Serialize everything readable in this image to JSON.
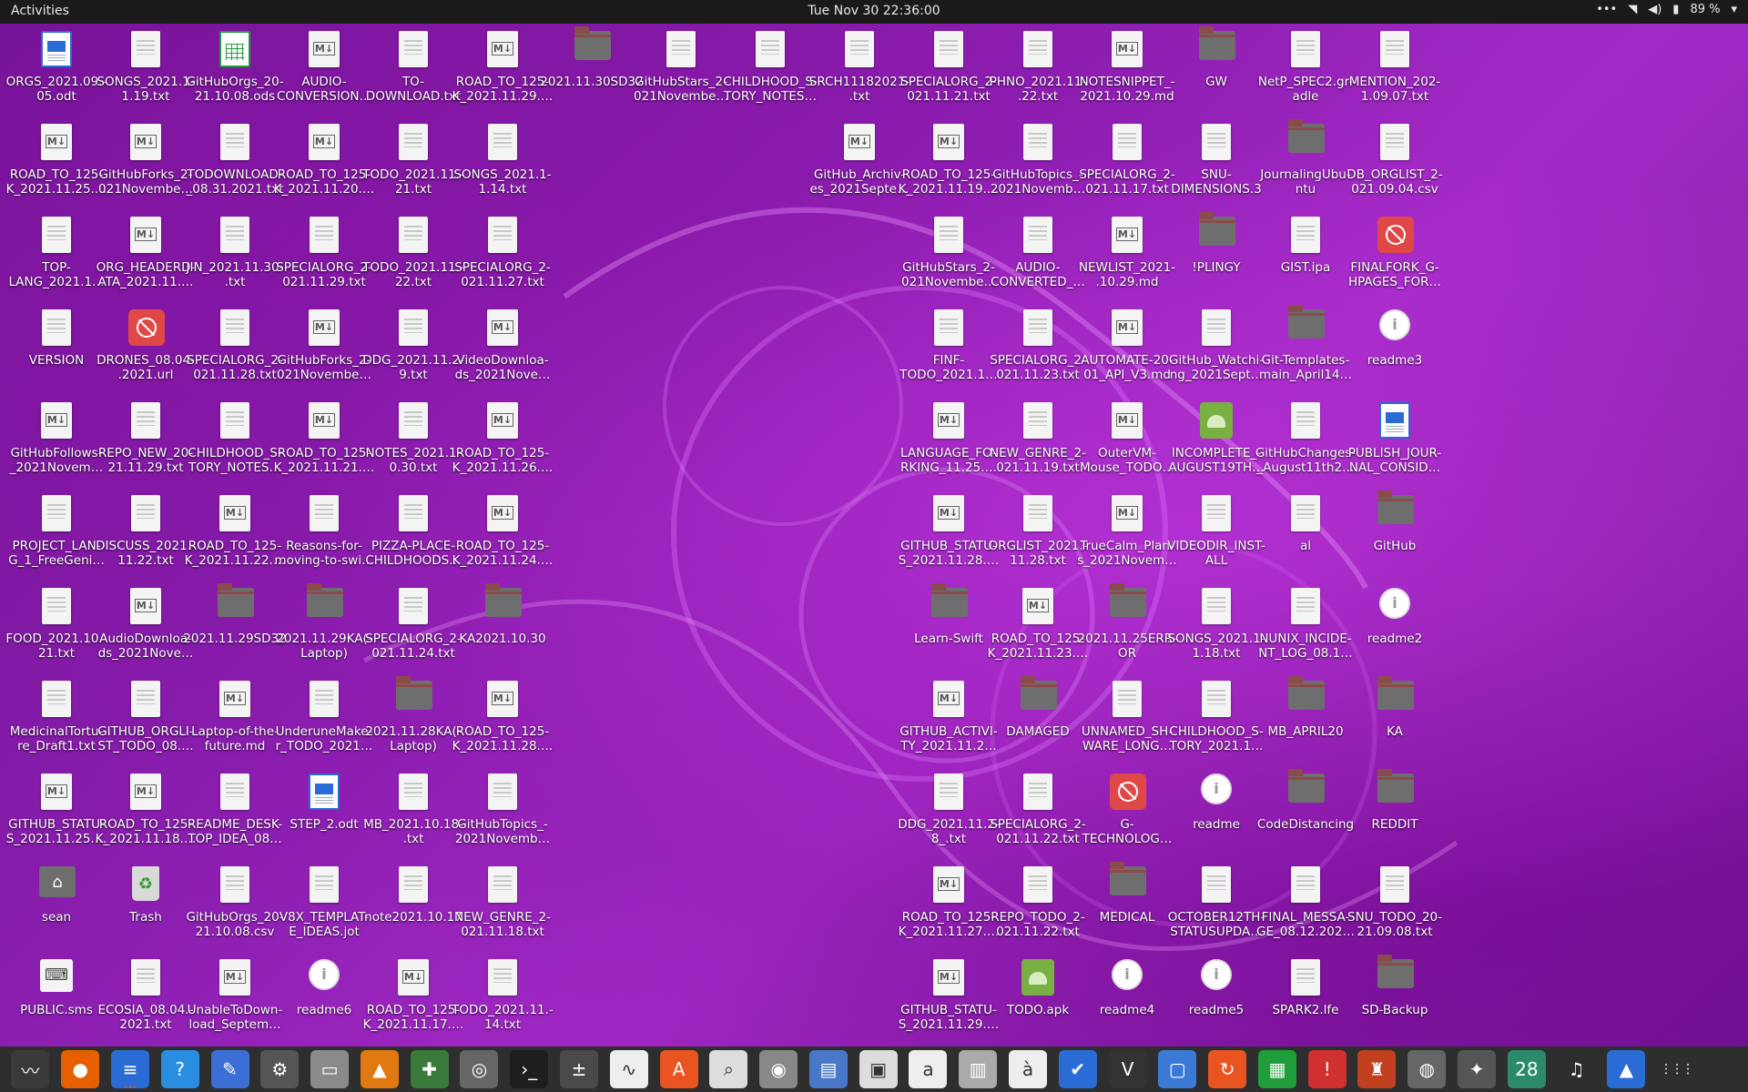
{
  "topbar": {
    "activities": "Activities",
    "clock": "Tue Nov 30  22:36:00",
    "battery": "89 %",
    "menu_dots": "•••"
  },
  "desktop_icons": [
    [
      "ORGS_2021.09.-\n05.odt",
      "odt"
    ],
    [
      "SONGS_2021.1-\n1.19.txt",
      "doc"
    ],
    [
      "GitHubOrgs_20-\n21.10.08.ods",
      "ods"
    ],
    [
      "AUDIO-\nCONVERSION…",
      "md"
    ],
    [
      "TO-\nDOWNLOAD.txt",
      "doc"
    ],
    [
      "ROAD_TO_125-\nK_2021.11.29.…",
      "md"
    ],
    [
      "2021.11.30SD32",
      "folder"
    ],
    [
      "GitHubStars_2-\n021Novembe…",
      "doc"
    ],
    [
      "CHILDHOOD_S-\nTORY_NOTES…",
      "doc"
    ],
    [
      "SRCH11182021-\n.txt",
      "doc"
    ],
    [
      "SPECIALORG_2-\n021.11.21.txt",
      "doc"
    ],
    [
      "PHNO_2021.11-\n.22.txt",
      "doc"
    ],
    [
      "NOTESNIPPET_-\n2021.10.29.md",
      "md"
    ],
    [
      "GW",
      "folder"
    ],
    [
      "NetP_SPEC2.gr-\nadle",
      "doc"
    ],
    [
      "MENTION_202-\n1.09.07.txt",
      "doc"
    ],
    [
      "ROAD_TO_125-\nK_2021.11.25.…",
      "md"
    ],
    [
      "GitHubForks_2-\n021Novembe…",
      "md"
    ],
    [
      "TODOWNLOAD-\n_08.31.2021.txt",
      "doc"
    ],
    [
      "ROAD_TO_125-\nK_2021.11.20.…",
      "md"
    ],
    [
      "TODO_2021.11.-\n21.txt",
      "doc"
    ],
    [
      "SONGS_2021.1-\n1.14.txt",
      "doc"
    ],
    [
      "GitHub_Archiv-\nes_2021Septe…",
      "md"
    ],
    [
      "ROAD_TO_125-\nK_2021.11.19.…",
      "md"
    ],
    [
      "GitHubTopics_-\n2021Novemb…",
      "doc"
    ],
    [
      "SPECIALORG_2-\n021.11.17.txt",
      "doc"
    ],
    [
      "SNU-\nDIMENSIONS.3",
      "doc"
    ],
    [
      "JournalingUbu-\nntu",
      "folder"
    ],
    [
      "DB_ORGLIST_2-\n021.09.04.csv",
      "doc"
    ],
    [
      "TOP-\nLANG_2021.1…",
      "doc"
    ],
    [
      "ORG_HEADERD-\nATA_2021.11.…",
      "md"
    ],
    [
      "JIN_2021.11.30-\n.txt",
      "doc"
    ],
    [
      "SPECIALORG_2-\n021.11.29.txt",
      "doc"
    ],
    [
      "TODO_2021.11.-\n22.txt",
      "doc"
    ],
    [
      "SPECIALORG_2-\n021.11.27.txt",
      "doc"
    ],
    [
      "GitHubStars_2-\n021Novembe…",
      "doc"
    ],
    [
      "AUDIO-\nCONVERTED_…",
      "doc"
    ],
    [
      "NEWLIST_2021-\n.10.29.md",
      "md"
    ],
    [
      "!PLINGY",
      "folder"
    ],
    [
      "GIST.ipa",
      "doc"
    ],
    [
      "FINALFORK_G-\nHPAGES_FOR…",
      "blocked"
    ],
    [
      "VERSION",
      "doc"
    ],
    [
      "DRONES_08.04-\n.2021.url",
      "blocked"
    ],
    [
      "SPECIALORG_2-\n021.11.28.txt",
      "doc"
    ],
    [
      "GitHubForks_2-\n021Novembe…",
      "md"
    ],
    [
      "DDG_2021.11.2-\n9.txt",
      "doc"
    ],
    [
      "VideoDownloa-\nds_2021Nove…",
      "md"
    ],
    [
      "FINF-\nTODO_2021.1…",
      "doc"
    ],
    [
      "SPECIALORG_2-\n021.11.23.txt",
      "doc"
    ],
    [
      "AUTOMATE-20-\n01_API_V3.md",
      "md"
    ],
    [
      "GitHub_Watchi-\nng_2021Sept…",
      "doc"
    ],
    [
      "Git-Templates-\nmain_April14…",
      "folder"
    ],
    [
      "readme3",
      "info"
    ],
    [
      "GitHubFollows-\n_2021Novem…",
      "md"
    ],
    [
      "REPO_NEW_20-\n21.11.29.txt",
      "doc"
    ],
    [
      "CHILDHOOD_S-\nTORY_NOTES…",
      "doc"
    ],
    [
      "ROAD_TO_125-\nK_2021.11.21.…",
      "md"
    ],
    [
      "NOTES_2021.1-\n0.30.txt",
      "doc"
    ],
    [
      "ROAD_TO_125-\nK_2021.11.26.…",
      "md"
    ],
    [
      "LANGUAGE_FO-\nRKING_11.25.…",
      "md"
    ],
    [
      "NEW_GENRE_2-\n021.11.19.txt",
      "doc"
    ],
    [
      "OuterVM-\nMouse_TODO…",
      "md"
    ],
    [
      "INCOMPLETE_-\nAUGUST19TH…",
      "apk"
    ],
    [
      "GitHubChanges-\n_August11th2…",
      "doc"
    ],
    [
      "PUBLISH_JOUR-\nNAL_CONSID…",
      "odt"
    ],
    [
      "PROJECT_LAN-\nG_1_FreeGeni…",
      "doc"
    ],
    [
      "DISCUSS_2021.-\n11.22.txt",
      "doc"
    ],
    [
      "ROAD_TO_125-\nK_2021.11.22.…",
      "md"
    ],
    [
      "Reasons-for-\nmoving-to-swi…",
      "doc"
    ],
    [
      "PIZZA-PLACE-\nCHILDHOODS…",
      "doc"
    ],
    [
      "ROAD_TO_125-\nK_2021.11.24.…",
      "md"
    ],
    [
      "GITHUB_STATU-\nS_2021.11.28.…",
      "md"
    ],
    [
      "ORGLIST_2021.-\n11.28.txt",
      "doc"
    ],
    [
      "TrueCalm_Plan-\ns_2021Novem…",
      "md"
    ],
    [
      "VIDEODIR_INST-\nALL",
      "doc"
    ],
    [
      "al",
      "doc"
    ],
    [
      "GitHub",
      "folder"
    ],
    [
      "FOOD_2021.10.-\n21.txt",
      "doc"
    ],
    [
      "AudioDownloa-\nds_2021Nove…",
      "md"
    ],
    [
      "2021.11.29SD32",
      "folder"
    ],
    [
      "2021.11.29KA(-\nLaptop)",
      "folder"
    ],
    [
      "SPECIALORG_2-\n021.11.24.txt",
      "doc"
    ],
    [
      "KA2021.10.30",
      "folder"
    ],
    [
      "Learn-Swift",
      "folder"
    ],
    [
      "ROAD_TO_125-\nK_2021.11.23.…",
      "md"
    ],
    [
      "2021.11.25ERR-\nOR",
      "folder"
    ],
    [
      "SONGS_2021.1-\n1.18.txt",
      "doc"
    ],
    [
      "NUNIX_INCIDE-\nNT_LOG_08.1…",
      "doc"
    ],
    [
      "readme2",
      "info"
    ],
    [
      "MedicinalTortu-\nre_Draft1.txt",
      "doc"
    ],
    [
      "GITHUB_ORGLI-\nST_TODO_08.…",
      "doc"
    ],
    [
      "Laptop-of-the-\nfuture.md",
      "md"
    ],
    [
      "UnderuneMake-\nr_TODO_2021…",
      "doc"
    ],
    [
      "2021.11.28KA(-\nLaptop)",
      "folder"
    ],
    [
      "ROAD_TO_125-\nK_2021.11.28.…",
      "md"
    ],
    [
      "GITHUB_ACTIVI-\nTY_2021.11.2…",
      "md"
    ],
    [
      "DAMAGED",
      "folder"
    ],
    [
      "UNNAMED_SH-\nWARE_LONG…",
      "doc"
    ],
    [
      "CHILDHOOD_S-\nTORY_2021.1…",
      "doc"
    ],
    [
      "MB_APRIL20",
      "folder"
    ],
    [
      "KA",
      "folder"
    ],
    [
      "GITHUB_STATU-\nS_2021.11.25.…",
      "md"
    ],
    [
      "ROAD_TO_125-\nK_2021.11.18.…",
      "md"
    ],
    [
      "README_DESK-\nTOP_IDEA_08…",
      "doc"
    ],
    [
      "STEP_2.odt",
      "odt"
    ],
    [
      "MB_2021.10.18-\n.txt",
      "doc"
    ],
    [
      "GitHubTopics_-\n2021Novemb…",
      "doc"
    ],
    [
      "DDG_2021.11.2-\n8_.txt",
      "doc"
    ],
    [
      "SPECIALORG_2-\n021.11.22.txt",
      "doc"
    ],
    [
      "G-\nTECHNOLOG…",
      "blocked"
    ],
    [
      "readme",
      "info"
    ],
    [
      "CodeDistancing",
      "folder"
    ],
    [
      "REDDIT",
      "folder"
    ],
    [
      "sean",
      "home"
    ],
    [
      "Trash",
      "trash"
    ],
    [
      "GitHubOrgs_20-\n21.10.08.csv",
      "doc"
    ],
    [
      "V8X_TEMPLAT-\nE_IDEAS.jot",
      "doc"
    ],
    [
      "note2021.10.17",
      "doc"
    ],
    [
      "NEW_GENRE_2-\n021.11.18.txt",
      "doc"
    ],
    [
      "ROAD_TO_125-\nK_2021.11.27.…",
      "md"
    ],
    [
      "REPO_TODO_2-\n021.11.22.txt",
      "doc"
    ],
    [
      "MEDICAL",
      "folder"
    ],
    [
      "OCTOBER12TH-\nSTATUSUPDA…",
      "doc"
    ],
    [
      "FINAL_MESSA-\nGE_08.12.202…",
      "doc"
    ],
    [
      "SNU_TODO_20-\n21.09.08.txt",
      "doc"
    ],
    [
      "PUBLIC.sms",
      "sms"
    ],
    [
      "ECOSIA_08.04.-\n2021.txt",
      "doc"
    ],
    [
      "UnableToDown-\nload_Septem…",
      "md"
    ],
    [
      "readme6",
      "info"
    ],
    [
      "ROAD_TO_125-\nK_2021.11.17.…",
      "md"
    ],
    [
      "TODO_2021.11.-\n14.txt",
      "doc"
    ],
    [
      "GITHUB_STATU-\nS_2021.11.29.…",
      "md"
    ],
    [
      "TODO.apk",
      "apk"
    ],
    [
      "readme4",
      "info"
    ],
    [
      "readme5",
      "info"
    ],
    [
      "SPARK2.lfe",
      "doc"
    ],
    [
      "SD-Backup",
      "folder"
    ]
  ],
  "dock": {
    "items": [
      {
        "name": "system-monitor",
        "glyph": "〰",
        "color": "#3a3a3a"
      },
      {
        "name": "firefox",
        "glyph": "●",
        "color": "#e66000"
      },
      {
        "name": "libreoffice-writer",
        "glyph": "≡",
        "color": "#2a6bd6"
      },
      {
        "name": "help",
        "glyph": "?",
        "color": "#2a8ee0"
      },
      {
        "name": "text-editor",
        "glyph": "✎",
        "color": "#3b6fd6"
      },
      {
        "name": "settings",
        "glyph": "⚙",
        "color": "#555"
      },
      {
        "name": "files",
        "glyph": "▭",
        "color": "#8a8a8a"
      },
      {
        "name": "vlc",
        "glyph": "▲",
        "color": "#e07a10"
      },
      {
        "name": "terminal-plus",
        "glyph": "✚",
        "color": "#3a7a3a"
      },
      {
        "name": "software-properties",
        "glyph": "◎",
        "color": "#666"
      },
      {
        "name": "terminal",
        "glyph": "›_",
        "color": "#1e1e1e"
      },
      {
        "name": "calculator",
        "glyph": "±",
        "color": "#4a4a4a"
      },
      {
        "name": "waveform",
        "glyph": "∿",
        "color": "#eee"
      },
      {
        "name": "app-store",
        "glyph": "A",
        "color": "#e95420"
      },
      {
        "name": "image-viewer",
        "glyph": "⌕",
        "color": "#ddd"
      },
      {
        "name": "disk-utility",
        "glyph": "◉",
        "color": "#888"
      },
      {
        "name": "document-viewer",
        "glyph": "▤",
        "color": "#4a78c8"
      },
      {
        "name": "screenshot",
        "glyph": "▣",
        "color": "#ddd"
      },
      {
        "name": "font-viewer",
        "glyph": "a",
        "color": "#eee"
      },
      {
        "name": "archive-manager",
        "glyph": "▥",
        "color": "#aaa"
      },
      {
        "name": "character-map",
        "glyph": "à",
        "color": "#eee"
      },
      {
        "name": "todo",
        "glyph": "✔",
        "color": "#2a6bd6"
      },
      {
        "name": "vim",
        "glyph": "V",
        "color": "#333"
      },
      {
        "name": "remote-desktop",
        "glyph": "▢",
        "color": "#3a7ad6"
      },
      {
        "name": "backup",
        "glyph": "↻",
        "color": "#e95420"
      },
      {
        "name": "libreoffice-calc",
        "glyph": "▦",
        "color": "#1f9d3a"
      },
      {
        "name": "alert",
        "glyph": "!",
        "color": "#d03030"
      },
      {
        "name": "game",
        "glyph": "♜",
        "color": "#c04020"
      },
      {
        "name": "camera",
        "glyph": "◍",
        "color": "#666"
      },
      {
        "name": "gimp",
        "glyph": "✦",
        "color": "#555"
      },
      {
        "name": "calendar",
        "glyph": "28",
        "color": "#2a8a6a"
      },
      {
        "name": "music",
        "glyph": "♫",
        "color": "#2e2e2e"
      },
      {
        "name": "terminal-monitor",
        "glyph": "▲",
        "color": "#2a6bd6"
      },
      {
        "name": "show-apps",
        "glyph": "⋮⋮⋮",
        "color": "#2e2e2e"
      }
    ]
  }
}
